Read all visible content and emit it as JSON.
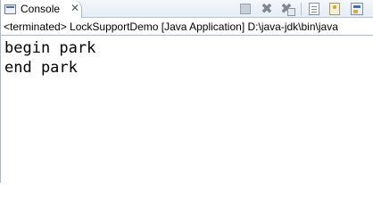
{
  "console": {
    "tab_label": "Console",
    "close_glyph": "✕",
    "description": "<terminated> LockSupportDemo [Java Application] D:\\java-jdk\\bin\\java",
    "output_lines": [
      "begin park",
      "end park"
    ]
  },
  "toolbar": {
    "icons": [
      "terminate-icon",
      "remove-launch-icon",
      "remove-all-terminated-icon",
      "clear-console-icon",
      "scroll-lock-icon",
      "open-console-icon"
    ],
    "remove_glyph": "✖",
    "remove_all_glyph": "✖"
  }
}
